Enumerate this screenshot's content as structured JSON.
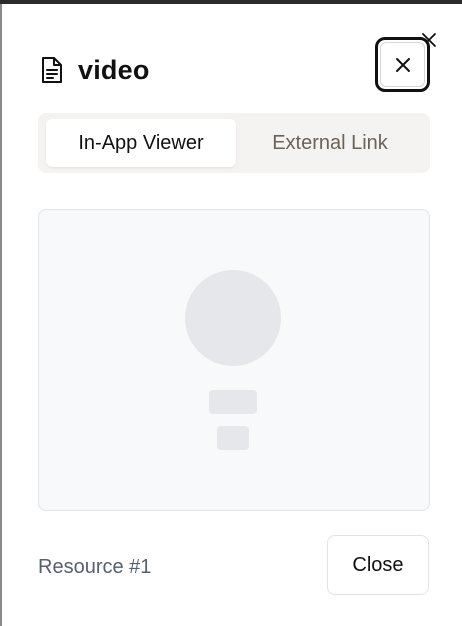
{
  "dialog": {
    "title": "video",
    "title_icon": "file-text-icon",
    "close_icon": "close-icon"
  },
  "tabs": [
    {
      "label": "In-App Viewer",
      "active": true
    },
    {
      "label": "External Link",
      "active": false
    }
  ],
  "viewer": {
    "state": "loading"
  },
  "footer": {
    "resource_label": "Resource #1",
    "close_label": "Close"
  },
  "colors": {
    "tab_background": "#f4f3f1",
    "skeleton": "#e6e7ea",
    "muted_text": "#556070",
    "inactive_tab_text": "#6b6258"
  }
}
